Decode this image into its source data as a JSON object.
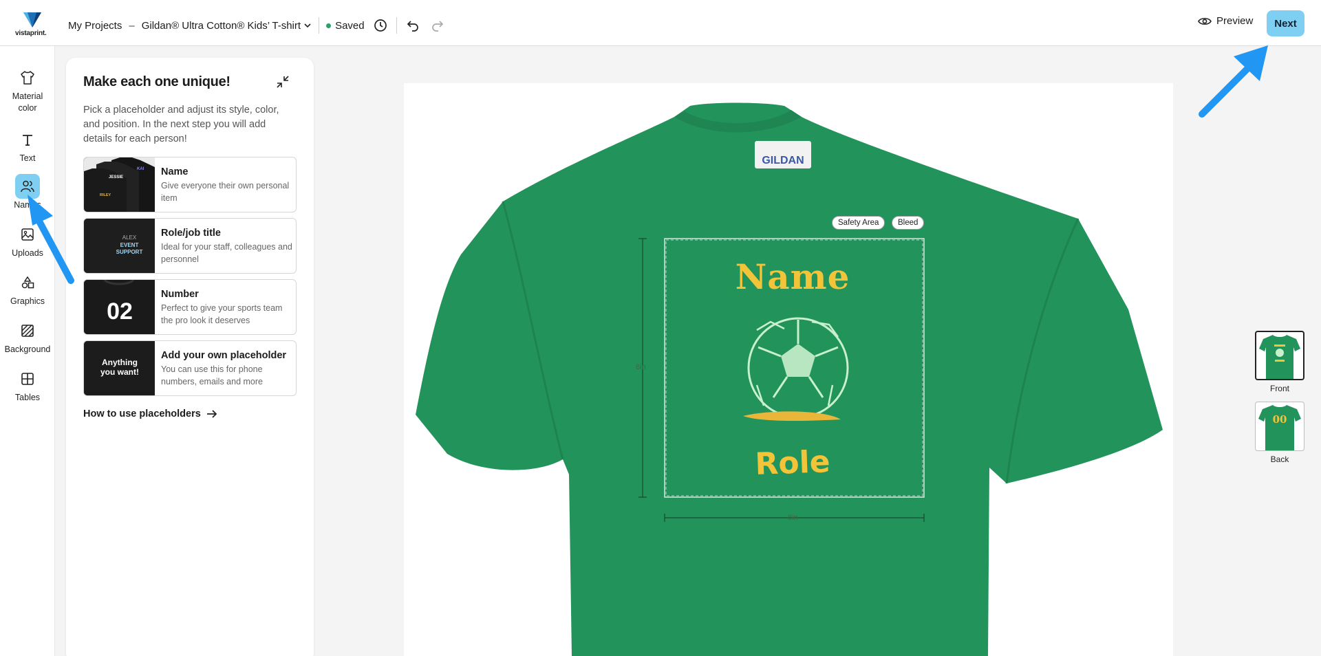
{
  "header": {
    "logo_text": "vistaprint.",
    "breadcrumb_projects": "My Projects",
    "separator": "–",
    "product_name": "Gildan® Ultra Cotton® Kids’ T-shirt",
    "saved_label": "Saved",
    "preview_label": "Preview",
    "next_label": "Next"
  },
  "rail": {
    "items": [
      {
        "label": "Material\ncolor",
        "icon": "tshirt-icon"
      },
      {
        "label": "Text",
        "icon": "text-icon"
      },
      {
        "label": "Names",
        "icon": "people-icon",
        "active": true
      },
      {
        "label": "Uploads",
        "icon": "image-upload-icon"
      },
      {
        "label": "Graphics",
        "icon": "shapes-icon"
      },
      {
        "label": "Background",
        "icon": "background-icon"
      },
      {
        "label": "Tables",
        "icon": "table-icon"
      }
    ]
  },
  "panel": {
    "title": "Make each one unique!",
    "description": "Pick a placeholder and adjust its style, color, and position. In the next step you will add details for each person!",
    "placeholders": [
      {
        "name": "Name",
        "description": "Give everyone their own personal item",
        "thumb_texts": [
          "JESSIE",
          "KAI",
          "RILEY"
        ]
      },
      {
        "name": "Role/job title",
        "description": "Ideal for your staff, colleagues and personnel",
        "thumb_texts": [
          "ALEX",
          "EVENT",
          "SUPPORT"
        ]
      },
      {
        "name": "Number",
        "description": "Perfect to give your sports team the pro look it deserves",
        "thumb_texts": [
          "02"
        ]
      },
      {
        "name": "Add your own placeholder",
        "description": "You can use this for phone numbers, emails and more",
        "thumb_texts": [
          "Anything",
          "you want!"
        ]
      }
    ],
    "howto_label": "How to use placeholders"
  },
  "canvas": {
    "shirt_color": "#23935c",
    "shirt_label_brand": "GILDAN",
    "safety_area_label": "Safety Area",
    "bleed_label": "Bleed",
    "design_name": "Name",
    "design_role": "Role",
    "height_label": "8in",
    "width_label": "8in",
    "accent_color": "#f2c43a"
  },
  "views": [
    {
      "label": "Front",
      "active": true
    },
    {
      "label": "Back",
      "active": false,
      "number": "00"
    }
  ],
  "colors": {
    "accent_button": "#7fcff2",
    "arrow": "#2196f3"
  }
}
